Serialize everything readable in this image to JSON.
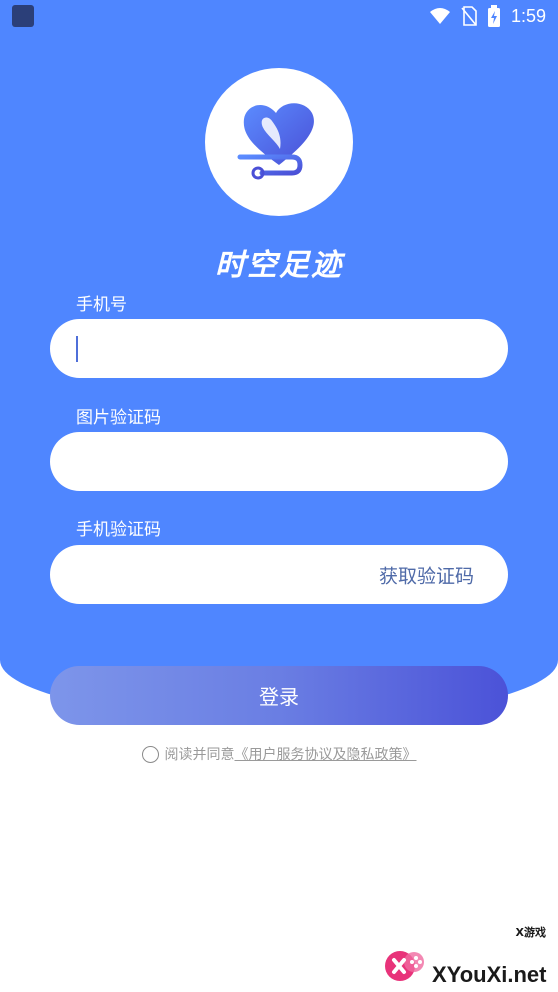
{
  "status_bar": {
    "time": "1:59",
    "icons": [
      "wifi-icon",
      "no-sim-icon",
      "battery-charging-icon"
    ]
  },
  "app": {
    "title": "时空足迹",
    "logo_icon": "heart-path-logo"
  },
  "form": {
    "phone": {
      "label": "手机号",
      "value": "",
      "placeholder": ""
    },
    "image_captcha": {
      "label": "图片验证码",
      "value": "",
      "placeholder": ""
    },
    "sms_code": {
      "label": "手机验证码",
      "value": "",
      "placeholder": "",
      "action_label": "获取验证码"
    }
  },
  "login_button": {
    "label": "登录"
  },
  "agreement": {
    "prefix": "阅读并同意",
    "link": "《用户服务协议及隐私政策》",
    "checked": false
  },
  "watermark": {
    "text": "XYouXi.net",
    "small_text": "X游戏"
  },
  "colors": {
    "primary_blue": "#4f86ff",
    "button_gradient_start": "#7d95ea",
    "button_gradient_end": "#4b52d8",
    "link_gray": "#9a9a9a"
  }
}
